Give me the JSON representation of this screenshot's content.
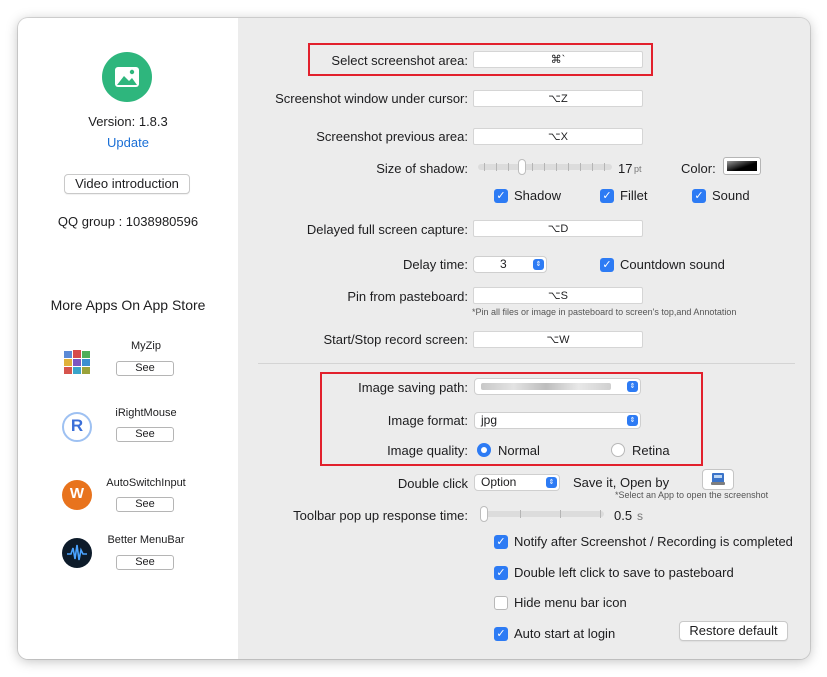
{
  "colors": {
    "accent": "#2d7bf4",
    "highlight_box": "#e2202c",
    "app_icon": "#2eb67d",
    "link": "#1a6fd6"
  },
  "sidebar": {
    "version": "Version: 1.8.3",
    "update_link": "Update",
    "video_button": "Video introduction",
    "qq_group": "QQ group : 1038980596",
    "more_apps_title": "More Apps On App Store",
    "apps": [
      {
        "name": "MyZip",
        "button": "See",
        "icon": "books-icon"
      },
      {
        "name": "iRightMouse",
        "button": "See",
        "icon": "r-logo-icon"
      },
      {
        "name": "AutoSwitchInput",
        "button": "See",
        "icon": "w-logo-icon"
      },
      {
        "name": "Better MenuBar",
        "button": "See",
        "icon": "waveform-icon"
      }
    ]
  },
  "settings": {
    "select_area": {
      "label": "Select screenshot area:",
      "shortcut": "⌘`"
    },
    "window_cursor": {
      "label": "Screenshot window under cursor:",
      "shortcut": "⌥Z"
    },
    "previous_area": {
      "label": "Screenshot previous area:",
      "shortcut": "⌥X"
    },
    "shadow": {
      "label": "Size of shadow:",
      "value": "17",
      "unit": "pt",
      "color_label": "Color:",
      "level": 0.3
    },
    "options": {
      "shadow": "Shadow",
      "fillet": "Fillet",
      "sound": "Sound"
    },
    "delayed_capture": {
      "label": "Delayed full screen capture:",
      "shortcut": "⌥D"
    },
    "delay_time": {
      "label": "Delay time:",
      "value": "3",
      "countdown": "Countdown sound"
    },
    "pin": {
      "label": "Pin from pasteboard:",
      "shortcut": "⌥S",
      "note": "*Pin all files or image in pasteboard to screen's top,and Annotation"
    },
    "record": {
      "label": "Start/Stop record screen:",
      "shortcut": "⌥W"
    },
    "saving_path": {
      "label": "Image saving path:"
    },
    "image_format": {
      "label": "Image format:",
      "value": "jpg"
    },
    "image_quality": {
      "label": "Image quality:",
      "normal": "Normal",
      "retina": "Retina"
    },
    "double_click": {
      "label": "Double click",
      "value": "Option",
      "open_with": "Save it, Open by",
      "note": "*Select an App to open the screenshot"
    },
    "toolbar_time": {
      "label": "Toolbar pop up response time:",
      "value": "0.5",
      "unit": "s",
      "level": 0.02
    },
    "notify": "Notify after Screenshot / Recording is completed",
    "double_left": "Double left click to save to pasteboard",
    "hide_icon": "Hide menu bar icon",
    "auto_start": "Auto start at login",
    "restore": "Restore default"
  }
}
